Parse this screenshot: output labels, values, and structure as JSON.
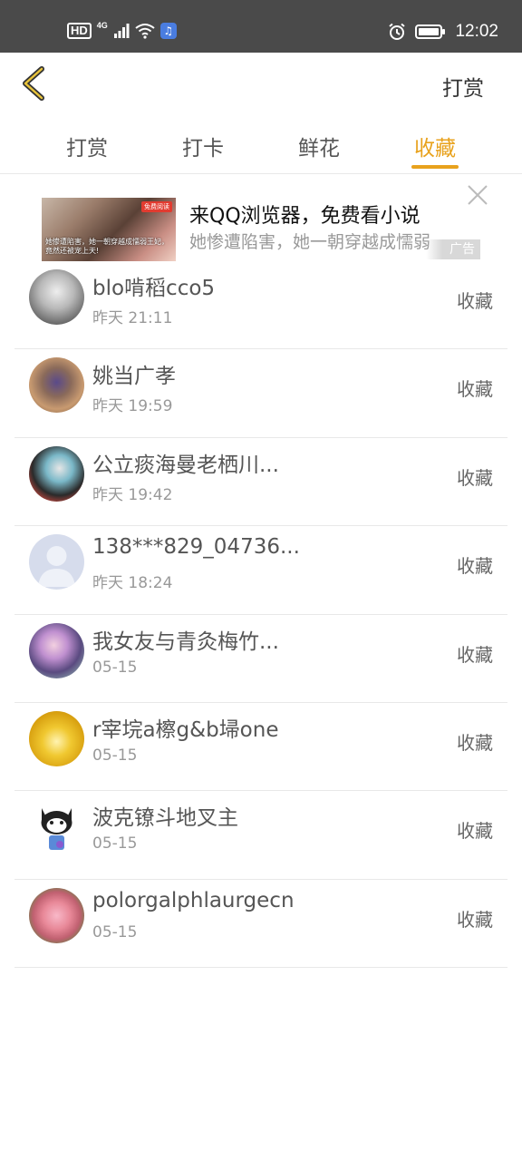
{
  "status_bar": {
    "hd": "HD",
    "network": "4G",
    "time": "12:02",
    "icons": [
      "signal-icon",
      "wifi-icon",
      "music-app-icon",
      "alarm-icon",
      "battery-icon"
    ]
  },
  "header": {
    "back_icon": "chevron-left-icon",
    "reward_label": "打赏"
  },
  "tabs": [
    {
      "label": "打赏",
      "active": false
    },
    {
      "label": "打卡",
      "active": false
    },
    {
      "label": "鲜花",
      "active": false
    },
    {
      "label": "收藏",
      "active": true
    }
  ],
  "ad": {
    "title": "来QQ浏览器，免费看小说",
    "description": "她惨遭陷害，她一朝穿越成懦弱",
    "badge": "广告",
    "image_badge": "免费阅读",
    "image_text": "她惨遭陷害，她一朝穿越成懦弱王妃，竟然还被宠上天!",
    "close_icon": "close-icon"
  },
  "list": [
    {
      "name": "blo啃稻cco5",
      "time": "昨天 21:11",
      "action": "收藏"
    },
    {
      "name": "姚当广孝",
      "time": "昨天 19:59",
      "action": "收藏"
    },
    {
      "name": "公立痰海曼老栖川...",
      "time": "昨天 19:42",
      "action": "收藏"
    },
    {
      "name": "138***829_04736...",
      "time": "昨天 18:24",
      "action": "收藏"
    },
    {
      "name": "我女友与青灸梅竹...",
      "time": "05-15",
      "action": "收藏"
    },
    {
      "name": "r宰垸a檫g&b埽one",
      "time": "05-15",
      "action": "收藏"
    },
    {
      "name": "波克镣斗地叉主",
      "time": "05-15",
      "action": "收藏"
    },
    {
      "name": "polorgalphlaurgecn",
      "time": "05-15",
      "action": "收藏"
    }
  ],
  "colors": {
    "accent": "#e8a21d",
    "status_bar": "#4a4a4a",
    "divider": "#e8e8e8"
  }
}
